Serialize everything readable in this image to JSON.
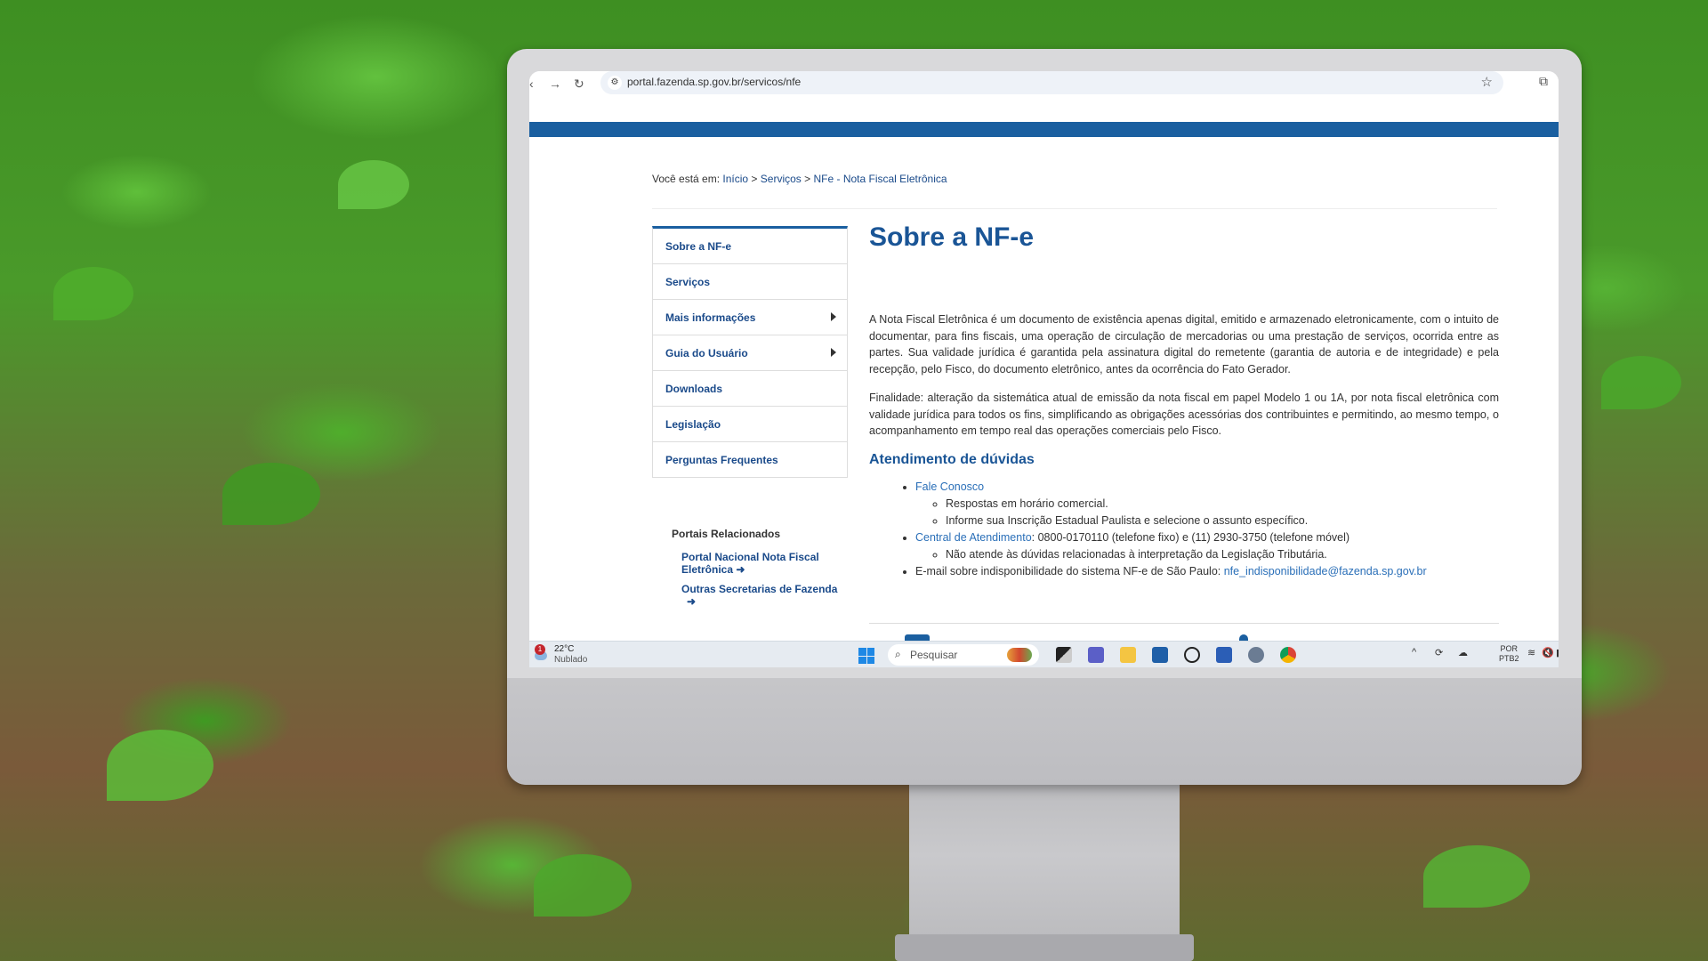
{
  "browser": {
    "url": "portal.fazenda.sp.gov.br/servicos/nfe",
    "icons": [
      "back-icon",
      "forward-icon",
      "reload-icon",
      "site-settings-icon",
      "star-icon",
      "extensions-icon"
    ]
  },
  "breadcrumb": {
    "prefix": "Você está em:",
    "items": [
      "Início",
      "Serviços",
      "NFe - Nota Fiscal Eletrônica"
    ],
    "separator": ">"
  },
  "sidebar": {
    "items": [
      {
        "label": "Sobre a NF-e",
        "submenu": false
      },
      {
        "label": "Serviços",
        "submenu": false
      },
      {
        "label": "Mais informações",
        "submenu": true
      },
      {
        "label": "Guia do Usuário",
        "submenu": true
      },
      {
        "label": "Downloads",
        "submenu": false
      },
      {
        "label": "Legislação",
        "submenu": false
      },
      {
        "label": "Perguntas Frequentes",
        "submenu": false
      }
    ],
    "related_title": "Portais Relacionados",
    "related": [
      {
        "label": "Portal Nacional Nota Fiscal Eletrônica",
        "line1": "Portal Nacional Nota Fiscal",
        "line2": "Eletrônica"
      },
      {
        "label": "Outras Secretarias de Fazenda",
        "line1": "Outras Secretarias de Fazenda",
        "line2": ""
      }
    ]
  },
  "main": {
    "title": "Sobre a NF-e",
    "paragraph1": "A Nota Fiscal Eletrônica é um documento de existência apenas digital, emitido e armazenado eletronicamente, com o intuito de documentar, para fins fiscais, uma operação de circulação de mercadorias ou uma prestação de serviços, ocorrida entre as partes. Sua validade jurídica é garantida pela assinatura digital do remetente (garantia de autoria e de integridade) e pela recepção, pelo Fisco, do documento eletrônico, antes da ocorrência do Fato Gerador.",
    "paragraph2": "Finalidade: alteração da sistemática atual de emissão da nota fiscal em papel Modelo 1 ou 1A, por nota fiscal eletrônica com validade jurídica para todos os fins, simplificando as obrigações acessórias dos contribuintes e permitindo, ao mesmo tempo, o acompanhamento em tempo real das operações comerciais pelo Fisco.",
    "support_title": "Atendimento de dúvidas",
    "support": {
      "fale_conosco": "Fale Conosco",
      "fale_sub": [
        "Respostas em horário comercial.",
        "Informe sua Inscrição Estadual Paulista e selecione o assunto específico."
      ],
      "central_link": "Central de Atendimento",
      "central_text": ": 0800-0170110 (telefone fixo) e (11) 2930-3750 (telefone móvel)",
      "central_sub": [
        "Não atende às dúvidas relacionadas à interpretação da Legislação Tributária."
      ],
      "email_text": "E-mail sobre indisponibilidade do sistema NF-e de São Paulo: ",
      "email_link": "nfe_indisponibilidade@fazenda.sp.gov.br"
    }
  },
  "taskbar": {
    "weather_badge": "1",
    "temperature": "22°C",
    "condition": "Nublado",
    "search_placeholder": "Pesquisar",
    "apps": [
      "task-view",
      "teams",
      "file-explorer",
      "microsoft-store",
      "dell",
      "word",
      "settings",
      "chrome"
    ],
    "lang_line1": "POR",
    "lang_line2": "PTB2"
  }
}
